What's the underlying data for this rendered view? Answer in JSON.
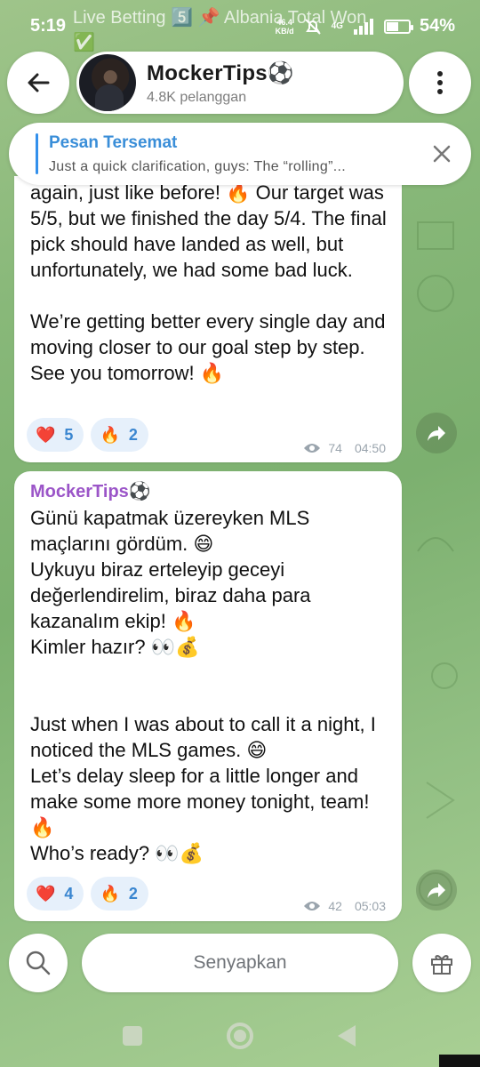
{
  "status_bar": {
    "time": "5:19",
    "notification_text": "Live Betting 5️⃣ 📌 Albania Total Won ✅",
    "net_speed": "46.4",
    "net_unit": "KB/d",
    "network": "4G",
    "battery": "54%",
    "battery_level": 0.54
  },
  "header": {
    "channel_name": "MockerTips⚽",
    "subscribers": "4.8K pelanggan"
  },
  "pinned": {
    "title": "Pesan Tersemat",
    "text": "Just a quick clarification, guys:  The “rolling”..."
  },
  "messages": [
    {
      "text": "again, just like before! 🔥 Our target was 5/5, but we finished the day 5/4. The final pick should have landed as well, but unfortunately, we had some bad luck.\n\nWe’re getting better every single day and moving closer to our goal step by step. See you tomorrow! 🔥",
      "reactions": [
        {
          "emoji": "❤️",
          "count": "5"
        },
        {
          "emoji": "🔥",
          "count": "2"
        }
      ],
      "views": "74",
      "time": "04:50"
    },
    {
      "sender": "MockerTips⚽",
      "text": "Günü kapatmak üzereyken MLS maçlarını gördüm. 😄\nUykuyu biraz erteleyip geceyi değerlendirelim, biraz daha para kazanalım ekip! 🔥\nKimler hazır? 👀💰\n\n\nJust when I was about to call it a night, I noticed the MLS games. 😄\nLet’s delay sleep for a little longer and make some more money tonight, team! 🔥\nWho’s ready? 👀💰",
      "reactions": [
        {
          "emoji": "❤️",
          "count": "4"
        },
        {
          "emoji": "🔥",
          "count": "2"
        }
      ],
      "views": "42",
      "time": "05:03"
    }
  ],
  "bottom": {
    "mute_label": "Senyapkan"
  },
  "colors": {
    "accent": "#3390ec",
    "sender": "#9b55c8",
    "reaction_bg": "#e6f0fb"
  }
}
